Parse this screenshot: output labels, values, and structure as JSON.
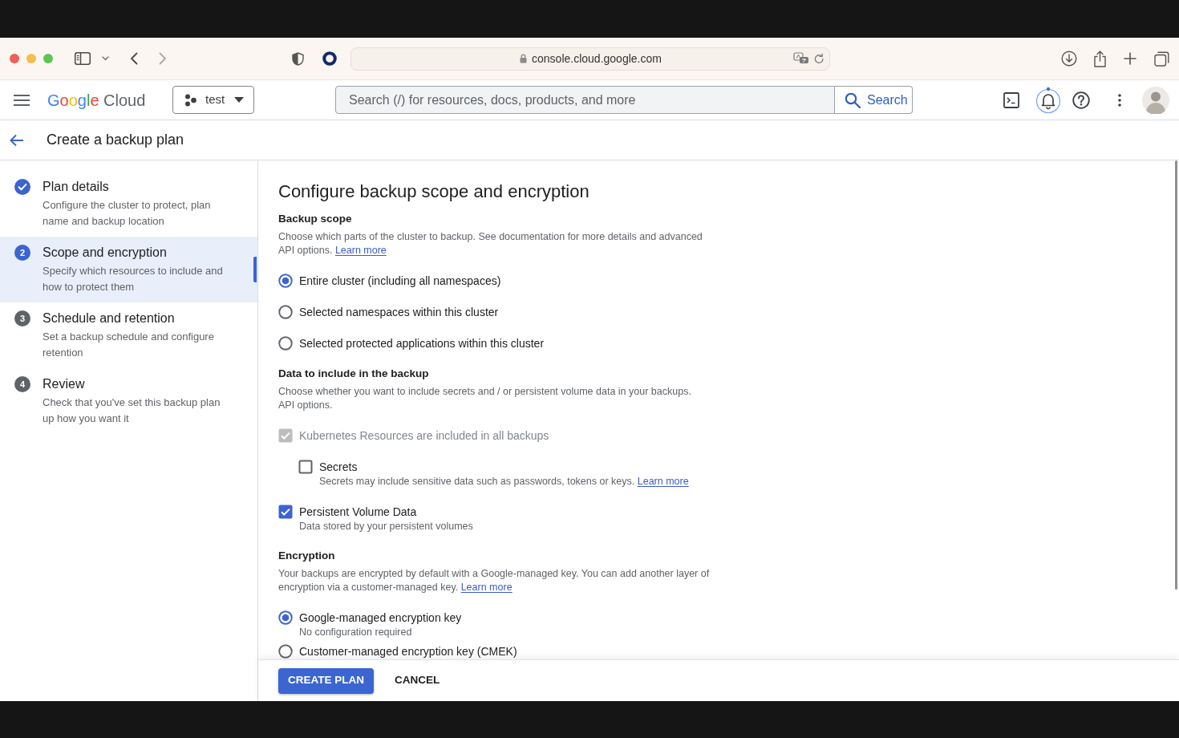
{
  "browser": {
    "url": "console.cloud.google.com"
  },
  "header": {
    "logo": "Google Cloud",
    "project": "test",
    "search": {
      "placeholder": "Search (/) for resources, docs, products, and more",
      "button": "Search"
    }
  },
  "page": {
    "title": "Create a backup plan"
  },
  "steps": [
    {
      "title": "Plan details",
      "description": "Configure the cluster to protect, plan name and backup location",
      "completed": true,
      "selected": false
    },
    {
      "number": "2",
      "title": "Scope and encryption",
      "description": "Specify which resources to include and how to protect them",
      "completed": false,
      "selected": true
    },
    {
      "number": "3",
      "title": "Schedule and retention",
      "description": "Set a backup schedule and configure retention",
      "completed": false,
      "selected": false
    },
    {
      "number": "4",
      "title": "Review",
      "description": "Check that you've set this backup plan up how you want it",
      "completed": false,
      "selected": false
    }
  ],
  "form": {
    "title": "Configure backup scope and encryption",
    "sections": [
      {
        "heading": "Backup scope",
        "description": "Choose which parts of the cluster to backup. See documentation for more details and advanced API options.",
        "link": "Learn more",
        "controls": [
          {
            "kind": "radio",
            "label": "Entire cluster (including all namespaces)",
            "selected": true
          },
          {
            "kind": "radio",
            "label": "Selected namespaces within this cluster",
            "selected": false
          },
          {
            "kind": "radio",
            "label": "Selected protected applications within this cluster",
            "selected": false
          }
        ]
      },
      {
        "heading": "Data to include in the backup",
        "description": "Choose whether you want to include secrets and / or persistent volume data in your backups. API options.",
        "controls": [
          {
            "kind": "checkbox",
            "label": "Kubernetes Resources are included in all backups",
            "checked": true,
            "disabled": true,
            "children": [
              {
                "kind": "checkbox",
                "label": "Secrets",
                "checked": false,
                "disabled": false,
                "description": "Secrets may include sensitive data such as passwords, tokens or keys.",
                "link": "Learn more"
              }
            ]
          },
          {
            "kind": "checkbox",
            "label": "Persistent Volume Data",
            "checked": true,
            "disabled": false,
            "description": "Data stored by your persistent volumes"
          }
        ]
      },
      {
        "heading": "Encryption",
        "description": "Your backups are encrypted by default with a Google-managed key. You can add another layer of encryption via a customer-managed key.",
        "link": "Learn more",
        "controls": [
          {
            "kind": "radio",
            "label": "Google-managed encryption key",
            "selected": true,
            "description": "No configuration required"
          },
          {
            "kind": "radio",
            "label": "Customer-managed encryption key (CMEK)",
            "selected": false
          }
        ]
      }
    ]
  },
  "footer": {
    "buttons": [
      {
        "kind": "primary",
        "label": "CREATE PLAN"
      },
      {
        "kind": "text",
        "label": "CANCEL"
      }
    ]
  }
}
